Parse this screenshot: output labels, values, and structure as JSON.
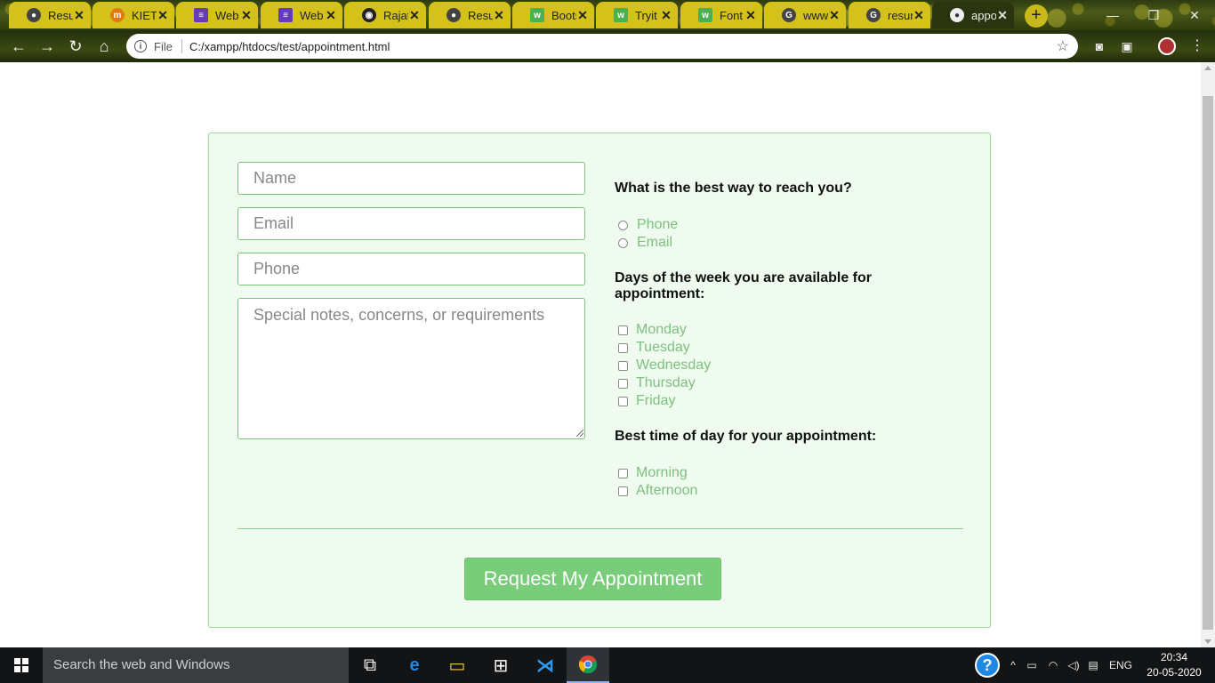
{
  "browser": {
    "tabs": [
      {
        "title": "Resun",
        "icon": "globe-icon",
        "color": "#444"
      },
      {
        "title": "KIET C",
        "icon": "kiet-icon",
        "color": "#e07a10"
      },
      {
        "title": "Web I",
        "icon": "list-icon",
        "color": "#673ab7"
      },
      {
        "title": "Web I",
        "icon": "list-icon",
        "color": "#673ab7"
      },
      {
        "title": "Rajat",
        "icon": "github-icon",
        "color": "#222"
      },
      {
        "title": "Resun",
        "icon": "globe-icon",
        "color": "#444"
      },
      {
        "title": "Boots",
        "icon": "w3schools-icon",
        "color": "#4caf50"
      },
      {
        "title": "Tryit I",
        "icon": "w3schools-icon",
        "color": "#4caf50"
      },
      {
        "title": "Font",
        "icon": "w3schools-icon",
        "color": "#4caf50"
      },
      {
        "title": "www",
        "icon": "google-icon",
        "color": "#444"
      },
      {
        "title": "resun",
        "icon": "google-icon",
        "color": "#444"
      },
      {
        "title": "appo",
        "icon": "globe-icon",
        "color": "#eee"
      }
    ],
    "address": {
      "file_label": "File",
      "url": "C:/xampp/htdocs/test/appointment.html"
    }
  },
  "form": {
    "name_placeholder": "Name",
    "email_placeholder": "Email",
    "phone_placeholder": "Phone",
    "notes_placeholder": "Special notes, concerns, or requirements",
    "contact_question": "What is the best way to reach you?",
    "contact_options": [
      "Phone",
      "Email"
    ],
    "days_question": "Days of the week you are available for appointment:",
    "days_options": [
      "Monday",
      "Tuesday",
      "Wednesday",
      "Thursday",
      "Friday"
    ],
    "time_question": "Best time of day for your appointment:",
    "time_options": [
      "Morning",
      "Afternoon"
    ],
    "submit_label": "Request My Appointment"
  },
  "taskbar": {
    "search_text": "Search the web and Windows",
    "language": "ENG",
    "time": "20:34",
    "date": "20-05-2020"
  },
  "colors": {
    "card_bg": "#eefbee",
    "accent_green": "#79cc79",
    "option_text": "#7fbf7f"
  }
}
